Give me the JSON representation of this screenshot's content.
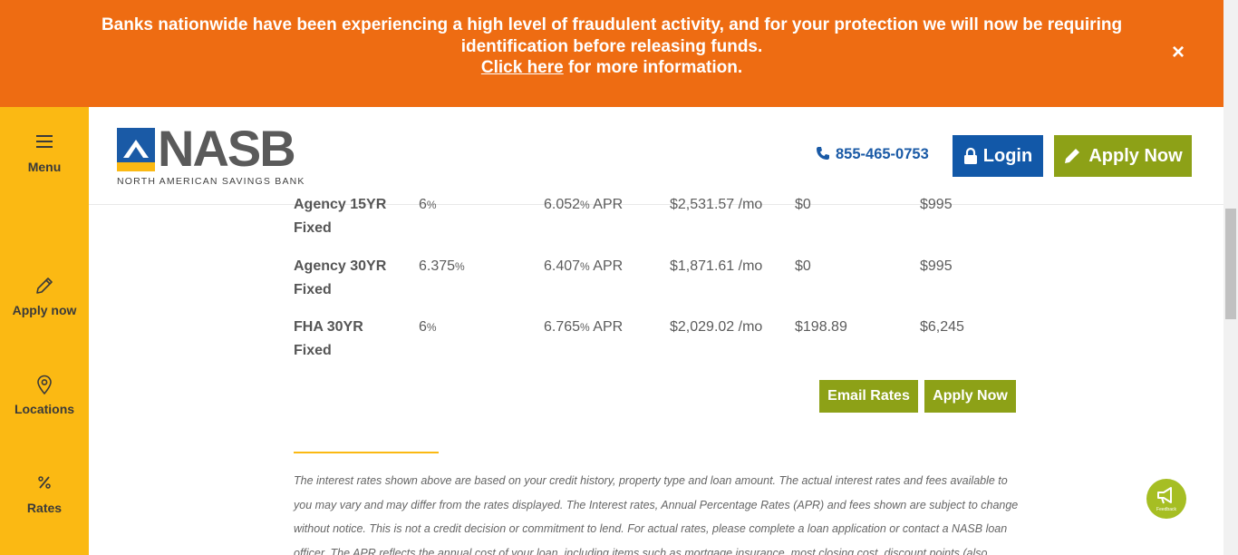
{
  "alert": {
    "line1": "Banks nationwide have been experiencing a high level of fraudulent activity, and for your protection we will now be requiring",
    "line2": "identification before releasing funds.",
    "link_text": "Click here",
    "line3_suffix": " for more information.",
    "close_glyph": "×",
    "bg_color": "#ee6c12"
  },
  "sidebar": {
    "bg_color": "#fbb913",
    "items": [
      {
        "label": "Menu",
        "icon": "hamburger-icon"
      },
      {
        "label": "Apply now",
        "icon": "pencil-icon"
      },
      {
        "label": "Locations",
        "icon": "map-pin-icon"
      },
      {
        "label": "Rates",
        "icon": "percent-icon"
      }
    ]
  },
  "header": {
    "logo_word": "NASB",
    "logo_sub": "NORTH AMERICAN SAVINGS BANK",
    "phone": "855-465-0753",
    "login_label": "Login",
    "apply_label": "Apply Now",
    "login_color": "#1258a8",
    "apply_color": "#8da117"
  },
  "rates": {
    "rows": [
      {
        "product": "Agency 15YR Fixed",
        "rate": "6",
        "apr": "6.052",
        "apr_suffix": " APR",
        "payment": "$2,531.57 /mo",
        "points": "$0",
        "fees": "$995"
      },
      {
        "product": "Agency 30YR Fixed",
        "rate": "6.375",
        "apr": "6.407",
        "apr_suffix": " APR",
        "payment": "$1,871.61 /mo",
        "points": "$0",
        "fees": "$995"
      },
      {
        "product": "FHA 30YR Fixed",
        "rate": "6",
        "apr": "6.765",
        "apr_suffix": " APR",
        "payment": "$2,029.02 /mo",
        "points": "$198.89",
        "fees": "$6,245"
      }
    ],
    "pct_symbol": "%",
    "email_label": "Email Rates",
    "apply_label": "Apply Now"
  },
  "disclaimer": "The interest rates shown above are based on your credit history, property type and loan amount. The actual interest rates and fees available to you may vary and may differ from the rates displayed. The Interest rates, Annual Percentage Rates (APR) and fees shown are subject to change without notice. This is not a credit decision or commitment to lend. For actual rates, please complete a loan application or contact a NASB loan officer. The APR reflects the annual cost of your loan, including items such as mortgage insurance, most closing cost, discount points (also",
  "feedback": {
    "label": "Feedback",
    "icon": "megaphone-icon"
  }
}
